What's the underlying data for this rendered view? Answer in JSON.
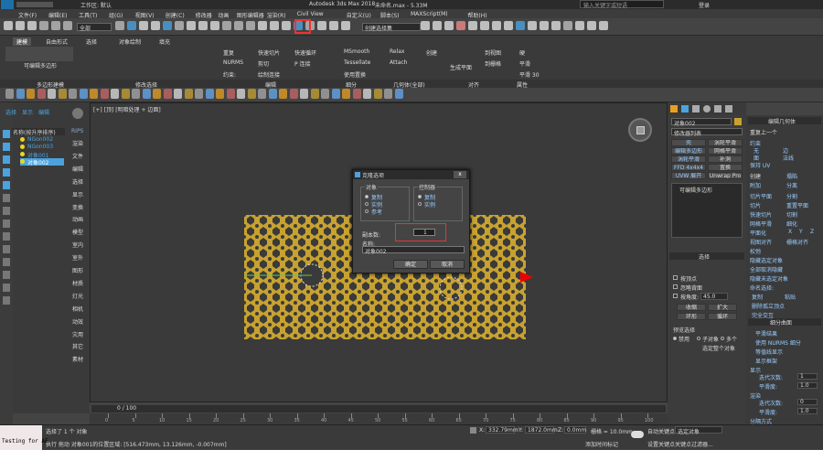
{
  "title": {
    "workspace": "工作区: 默认",
    "app": "Autodesk 3ds Max 2018",
    "file": "未命名.max - 5.33M",
    "search_placeholder": "输入关键字或短语",
    "login": "登录"
  },
  "menu": [
    "文件(F)",
    "编辑(E)",
    "工具(T)",
    "组(G)",
    "视图(V)",
    "创建(C)",
    "修改器",
    "动画",
    "图形编辑器",
    "渲染(R)",
    "Civil View",
    "自定义(U)",
    "脚本(S)",
    "MAXScript(M)",
    "帮助(H)"
  ],
  "toolbar": {
    "filter": "全部",
    "selection_set": "创建选择集"
  },
  "ribbon": {
    "tabs": [
      "建模",
      "自由形式",
      "选择",
      "对象绘制",
      "填充"
    ],
    "sections": [
      "多边形建模",
      "修改选择",
      "编辑",
      "细分",
      "几何体(全部)",
      "对齐",
      "属性"
    ],
    "poly_label": "可编辑多边形",
    "items": [
      "重复",
      "快速切片",
      "快速循环",
      "NURMS",
      "剪切",
      "P 连接",
      "约束:",
      "绘制连接",
      "MSmooth",
      "Tessellate",
      "使用置换",
      "Relax",
      "Attach",
      "创建",
      "生成平面",
      "到视图",
      "到栅格",
      "X",
      "Y",
      "Z",
      "平滑",
      "平滑 30",
      "硬"
    ]
  },
  "scene_explorer": {
    "tabs": [
      "选择",
      "显示",
      "编辑"
    ],
    "header": "名称(按升序排序)",
    "items": [
      "NGon002",
      "NGon003",
      "对象001",
      "对象002"
    ],
    "side_items": [
      "渲染",
      "文件",
      "编辑",
      "选择",
      "显示",
      "变换",
      "动画",
      "模型",
      "室内",
      "室外",
      "图形",
      "材质",
      "灯光",
      "相机",
      "动效",
      "灾用",
      "其它",
      "素材"
    ]
  },
  "viewport": {
    "label": "[+] [顶] [明暗处理 + 边面]",
    "cube": "顶"
  },
  "dialog": {
    "title": "克隆选项",
    "group_object": "对象",
    "object_options": [
      "复制",
      "实例",
      "参考"
    ],
    "group_controller": "控制器",
    "controller_options": [
      "复制",
      "实例"
    ],
    "copies_label": "副本数:",
    "copies_value": "1",
    "name_label": "名称:",
    "name_value": "对象002",
    "ok": "确定",
    "cancel": "取消"
  },
  "command_panel": {
    "object_name": "对象002",
    "modifier_list": "修改器列表",
    "buttons": [
      "壳",
      "涡轮平滑",
      "编辑多边形",
      "网格平滑",
      "涡轮平滑",
      "补洞",
      "FFD 4x4x4",
      "置换",
      "UVW 展开",
      "Unwrap Pro"
    ],
    "stack_item": "可编辑多边形",
    "select_rollout": "选择",
    "select_items": [
      "按顶点",
      "忽略背面",
      "按角度:",
      "收缩",
      "扩大",
      "环形",
      "循环"
    ],
    "angle_value": "45.0",
    "preview_label": "预览选择",
    "preview_options": [
      "禁用",
      "子对象",
      "多个"
    ],
    "selected_count": "选定整个对象"
  },
  "edit_geom": {
    "title": "编辑几何体",
    "items": [
      "重复上一个",
      "约束",
      "无",
      "边",
      "面",
      "法线",
      "保持 UV",
      "创建",
      "塌陷",
      "附加",
      "分离",
      "切片平面",
      "分割",
      "切片",
      "重置平面",
      "快速切片",
      "切割",
      "网格平滑",
      "细化",
      "平面化",
      "X",
      "Y",
      "Z",
      "视图对齐",
      "栅格对齐",
      "松弛",
      "隐藏选定对象",
      "全部取消隐藏",
      "隐藏未选定对象",
      "命名选择:",
      "复制",
      "粘贴",
      "删除孤立顶点",
      "完全交互"
    ],
    "subdiv_title": "细分曲面",
    "subdiv_items": [
      "平滑结果",
      "使用 NURMS 细分",
      "等值线显示",
      "显示框架",
      "显示",
      "迭代次数:",
      "平滑度:",
      "渲染",
      "迭代次数:",
      "平滑度:",
      "分隔方式",
      "平滑组",
      "材质"
    ],
    "iter1": "1",
    "smooth1": "1.0",
    "iter2": "0",
    "smooth2": "1.0"
  },
  "timeline": {
    "frame": "0 / 100",
    "ticks": [
      "0",
      "5",
      "10",
      "15",
      "20",
      "25",
      "30",
      "35",
      "40",
      "45",
      "50",
      "55",
      "60",
      "65",
      "70",
      "75",
      "80",
      "85",
      "90",
      "95",
      "100"
    ]
  },
  "status": {
    "maxscript": "Testing for AE",
    "selected": "选择了 1 个 对象",
    "hint": "执行 拖动 对象001的位置区域: [516.473mm, 13.126mm, -0.007mm]",
    "x": "332.79mm",
    "y": "1872.0mm",
    "z": "0.0mm",
    "grid": "栅格 = 10.0mm",
    "add_time": "添加时间标记",
    "autokey": "自动关键点",
    "set_key": "设置关键点",
    "filter": "选定对象",
    "key_filter": "关键点过滤器..."
  },
  "colors": {
    "accent": "#4aa3df",
    "selection": "#e33",
    "bg": "#444444",
    "viewport": "#3a3a3a",
    "pattern": "#c8a230"
  }
}
